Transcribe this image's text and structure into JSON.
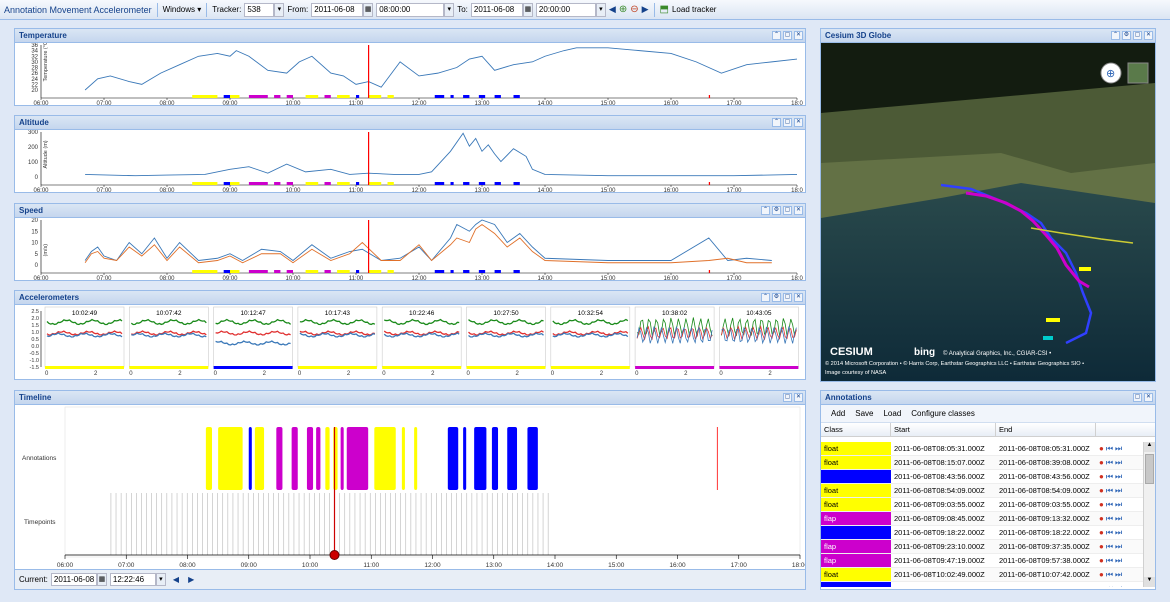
{
  "toolbar": {
    "app_title": "Annotation Movement Accelerometer",
    "windows_label": "Windows ▾",
    "tracker_label": "Tracker:",
    "tracker_value": "538",
    "from_label": "From:",
    "from_date": "2011-06-08",
    "from_time": "08:00:00",
    "to_label": "To:",
    "to_date": "2011-06-08",
    "to_time": "20:00:00",
    "load_label": "Load tracker"
  },
  "hours": [
    "06:00",
    "07:00",
    "08:00",
    "09:00",
    "10:00",
    "11:00",
    "12:00",
    "13:00",
    "14:00",
    "15:00",
    "16:00",
    "17:00",
    "18:0"
  ],
  "temperature": {
    "title": "Temperature",
    "ylabel": "Temperature (°C)",
    "yticks": [
      "36",
      "34",
      "32",
      "30",
      "28",
      "26",
      "24",
      "22",
      "20"
    ],
    "chart_data": {
      "type": "line",
      "title": "Temperature",
      "ylabel": "Temperature (°C)",
      "ylim": [
        20,
        36
      ],
      "x_hours": [
        6.7,
        6.9,
        7.1,
        7.4,
        7.6,
        7.9,
        8.2,
        8.5,
        8.8,
        9.0,
        9.1,
        9.3,
        9.6,
        9.9,
        10.1,
        10.3,
        10.6,
        10.8,
        11.0,
        11.2,
        11.4,
        11.7,
        12.0,
        12.3,
        12.6,
        12.8,
        13.0,
        13.2,
        13.5,
        13.8,
        14.0,
        14.3,
        14.5,
        15.0,
        15.5,
        16.0,
        16.4,
        16.8,
        17.2,
        17.6,
        18.0
      ],
      "values": [
        20,
        24,
        25,
        23,
        22,
        26,
        29,
        32,
        33,
        32,
        34,
        32,
        27,
        26,
        30,
        32,
        26,
        25,
        22,
        23,
        21,
        30,
        25,
        26,
        28,
        31,
        32,
        27,
        29,
        30,
        32,
        34,
        35,
        35,
        34,
        33,
        30,
        26,
        29,
        30,
        31
      ]
    }
  },
  "altitude": {
    "title": "Altitude",
    "ylabel": "Altitude (m)",
    "yticks": [
      "300",
      "200",
      "100",
      "0"
    ],
    "chart_data": {
      "type": "line",
      "title": "Altitude",
      "ylabel": "Altitude (m)",
      "ylim": [
        0,
        350
      ],
      "x_hours": [
        6.7,
        7.5,
        8.0,
        8.6,
        9.0,
        9.3,
        9.6,
        9.9,
        10.2,
        10.6,
        10.9,
        11.2,
        11.6,
        12.0,
        12.2,
        12.5,
        12.7,
        12.8,
        12.9,
        13.0,
        13.1,
        13.2,
        13.3,
        13.5,
        13.7,
        13.8,
        14.0,
        15.0,
        16.0,
        17.0,
        18.0
      ],
      "values": [
        20,
        10,
        15,
        20,
        60,
        80,
        30,
        100,
        40,
        60,
        20,
        30,
        20,
        20,
        40,
        200,
        340,
        240,
        300,
        200,
        250,
        180,
        120,
        220,
        160,
        60,
        20,
        10,
        10,
        10,
        20
      ]
    }
  },
  "speed": {
    "title": "Speed",
    "ylabel": "(m/s)",
    "yticks": [
      "20",
      "15",
      "10",
      "5",
      "0"
    ],
    "chart_data": {
      "type": "line",
      "title": "Speed",
      "ylabel": "(m/s)",
      "ylim": [
        0,
        20
      ],
      "x_hours": [
        6.7,
        6.8,
        6.9,
        7.0,
        7.2,
        7.4,
        7.6,
        7.8,
        8.0,
        8.2,
        8.5,
        8.8,
        9.0,
        9.2,
        9.5,
        9.8,
        10.0,
        10.3,
        10.6,
        10.9,
        11.1,
        11.4,
        11.7,
        12.0,
        12.2,
        12.5,
        12.6,
        12.8,
        12.9,
        13.0,
        13.2,
        13.4,
        13.6,
        13.8,
        14.0,
        15.0,
        16.0,
        16.6,
        16.9,
        17.2,
        17.6
      ],
      "series": [
        {
          "values": [
            2,
            6,
            8,
            4,
            2,
            10,
            5,
            12,
            3,
            10,
            2,
            3,
            5,
            2,
            7,
            6,
            2,
            9,
            3,
            6,
            7,
            2,
            3,
            8,
            2,
            12,
            18,
            15,
            18,
            20,
            18,
            10,
            14,
            8,
            3,
            2,
            2,
            12,
            2,
            3,
            2
          ]
        },
        {
          "values": [
            1,
            5,
            6,
            3,
            2,
            8,
            4,
            9,
            2,
            8,
            1,
            2,
            4,
            1,
            5,
            5,
            1,
            7,
            2,
            5,
            10,
            2,
            2,
            9,
            2,
            9,
            12,
            10,
            16,
            18,
            14,
            8,
            12,
            6,
            2,
            1,
            1,
            2,
            3,
            1,
            1
          ]
        }
      ]
    }
  },
  "accel": {
    "title": "Accelerometers",
    "yticks": [
      "2.5",
      "2.0",
      "1.5",
      "1.0",
      "0.5",
      "0.0",
      "-0.5",
      "-1.0",
      "-1.5"
    ],
    "frames": [
      {
        "time": "10:02:49",
        "cls": "#ffff00",
        "x0": "0",
        "x1": "2"
      },
      {
        "time": "10:07:42",
        "cls": "#ffff00",
        "x0": "0",
        "x1": "2"
      },
      {
        "time": "10:12:47",
        "cls": "#0000ff",
        "x0": "0",
        "x1": "2"
      },
      {
        "time": "10:17:43",
        "cls": "#ffff00",
        "x0": "0",
        "x1": "2"
      },
      {
        "time": "10:22:46",
        "cls": "#ffff00",
        "x0": "0",
        "x1": "2"
      },
      {
        "time": "10:27:50",
        "cls": "#ffff00",
        "x0": "0",
        "x1": "2"
      },
      {
        "time": "10:32:54",
        "cls": "#ffff00",
        "x0": "0",
        "x1": "2"
      },
      {
        "time": "10:38:02",
        "cls": "#cc00cc",
        "x0": "0",
        "x1": "2"
      },
      {
        "time": "10:43:05",
        "cls": "#cc00cc",
        "x0": "0",
        "x1": "2"
      }
    ]
  },
  "globe": {
    "title": "Cesium 3D Globe",
    "logo": "CESIUM",
    "bing": "bing",
    "credit1": "© Analytical Graphics, Inc., CGIAR-CSI •",
    "credit2": "© 2014 Microsoft Corporation • © Harris Corp, Earthstar Geographics LLC • Earthstar Geographics SIO •",
    "credit3": "Image courtesy of NASA"
  },
  "timeline": {
    "title": "Timeline",
    "row_annotations": "Annotations",
    "row_timepoints": "Timepoints",
    "current_label": "Current:",
    "current_date": "2011-06-08",
    "current_time": "12:22:46",
    "hours": [
      "06:00",
      "07:00",
      "08:00",
      "09:00",
      "10:00",
      "11:00",
      "12:00",
      "13:00",
      "14:00",
      "15:00",
      "16:00",
      "17:00",
      "18:00"
    ]
  },
  "annotations": {
    "title": "Annotations",
    "add": "Add",
    "save": "Save",
    "load": "Load",
    "configure": "Configure classes",
    "col_class": "Class",
    "col_start": "Start",
    "col_end": "End",
    "rows": [
      {
        "cls": "float",
        "color": "#ffff00",
        "start": "2011-06-08T08:05:31.000Z",
        "end": "2011-06-08T08:05:31.000Z"
      },
      {
        "cls": "float",
        "color": "#ffff00",
        "start": "2011-06-08T08:15:07.000Z",
        "end": "2011-06-08T08:39:08.000Z"
      },
      {
        "cls": "",
        "color": "#0000ff",
        "start": "2011-06-08T08:43:56.000Z",
        "end": "2011-06-08T08:43:56.000Z"
      },
      {
        "cls": "float",
        "color": "#ffff00",
        "start": "2011-06-08T08:54:09.000Z",
        "end": "2011-06-08T08:54:09.000Z"
      },
      {
        "cls": "float",
        "color": "#ffff00",
        "start": "2011-06-08T09:03:55.000Z",
        "end": "2011-06-08T09:03:55.000Z"
      },
      {
        "cls": "flap",
        "color": "#cc00cc",
        "start": "2011-06-08T09:08:45.000Z",
        "end": "2011-06-08T09:13:32.000Z"
      },
      {
        "cls": "",
        "color": "#0000ff",
        "start": "2011-06-08T09:18:22.000Z",
        "end": "2011-06-08T09:18:22.000Z"
      },
      {
        "cls": "flap",
        "color": "#cc00cc",
        "start": "2011-06-08T09:23:10.000Z",
        "end": "2011-06-08T09:37:35.000Z"
      },
      {
        "cls": "flap",
        "color": "#cc00cc",
        "start": "2011-06-08T09:47:19.000Z",
        "end": "2011-06-08T09:57:38.000Z"
      },
      {
        "cls": "float",
        "color": "#ffff00",
        "start": "2011-06-08T10:02:49.000Z",
        "end": "2011-06-08T10:07:42.000Z"
      },
      {
        "cls": "",
        "color": "#0000ff",
        "start": "",
        "end": ""
      }
    ]
  }
}
